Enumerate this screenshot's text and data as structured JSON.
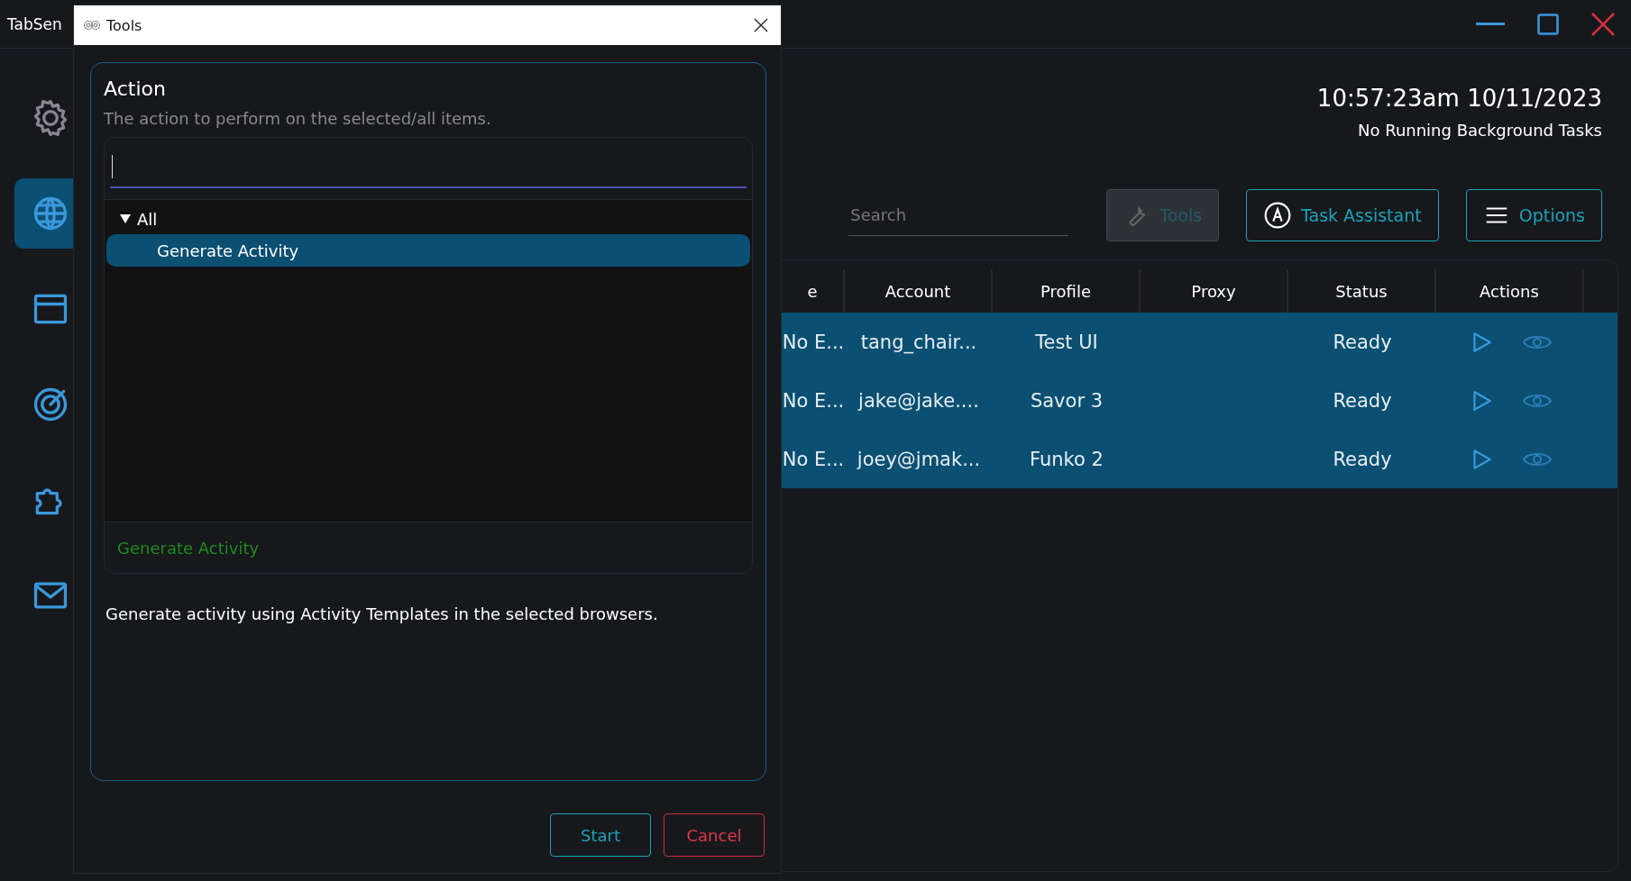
{
  "app": {
    "title": "TabSen"
  },
  "sidebar": {
    "items": [
      {
        "kind": "gear",
        "selected": false
      },
      {
        "kind": "globe",
        "selected": true
      },
      {
        "kind": "browser",
        "selected": false
      },
      {
        "kind": "target",
        "selected": false
      },
      {
        "kind": "puzzle",
        "selected": false
      },
      {
        "kind": "mail",
        "selected": false
      }
    ]
  },
  "header": {
    "time": "10:57:23am 10/11/2023",
    "status": "No Running Background Tasks"
  },
  "toolbar": {
    "search": {
      "placeholder": "Search"
    },
    "buttons": [
      {
        "label": "Tools",
        "kind": "tools",
        "disabled": true
      },
      {
        "label": "Task Assistant",
        "kind": "assistant",
        "disabled": false
      },
      {
        "label": "Options",
        "kind": "options",
        "disabled": false
      }
    ]
  },
  "table": {
    "columns": [
      "e",
      "Account",
      "Profile",
      "Proxy",
      "Status",
      "Actions"
    ],
    "rows": [
      {
        "selected": true,
        "column_1": "No E...",
        "account": "tang_chair...",
        "profile": "Test UI",
        "status": "Ready"
      },
      {
        "selected": true,
        "column_1": "No E...",
        "account": "jake@jake....",
        "profile": "Savor 3",
        "status": "Ready"
      },
      {
        "selected": true,
        "column_1": "No E...",
        "account": "joey@jmak...",
        "profile": "Funko 2",
        "status": "Ready"
      }
    ]
  },
  "dialog": {
    "title": "Tools",
    "section": {
      "title": "Action",
      "description": "The action to perform on the selected/all items."
    },
    "tree": [
      {
        "label": "All",
        "expanded": true,
        "children": [
          {
            "label": "Generate Activity",
            "selected": true
          }
        ]
      }
    ],
    "chosen": "Generate Activity",
    "details": "Generate activity using Activity Templates in the selected browsers.",
    "buttons": [
      {
        "label": "Start",
        "kind": "primary"
      },
      {
        "label": "Cancel",
        "kind": "cancel"
      }
    ]
  }
}
